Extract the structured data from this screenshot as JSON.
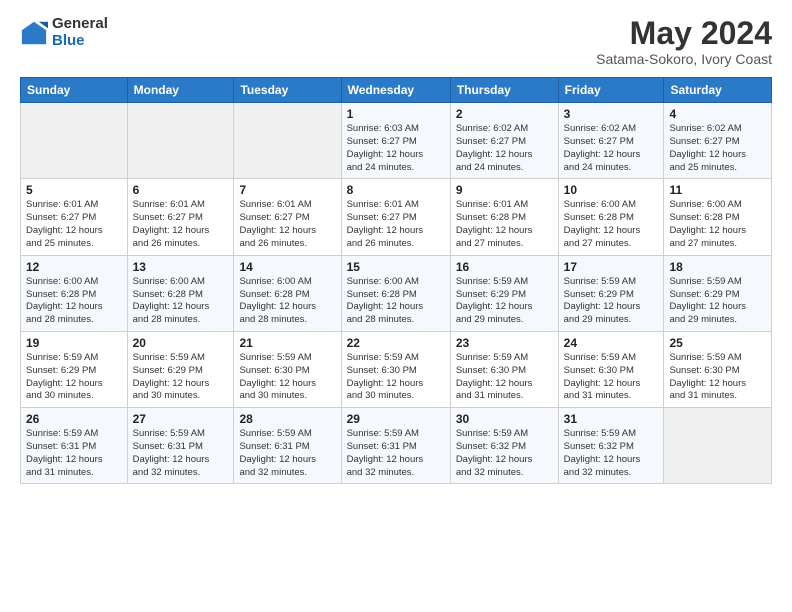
{
  "logo": {
    "general": "General",
    "blue": "Blue"
  },
  "title": "May 2024",
  "location": "Satama-Sokoro, Ivory Coast",
  "weekdays": [
    "Sunday",
    "Monday",
    "Tuesday",
    "Wednesday",
    "Thursday",
    "Friday",
    "Saturday"
  ],
  "weeks": [
    [
      {
        "num": "",
        "detail": ""
      },
      {
        "num": "",
        "detail": ""
      },
      {
        "num": "",
        "detail": ""
      },
      {
        "num": "1",
        "detail": "Sunrise: 6:03 AM\nSunset: 6:27 PM\nDaylight: 12 hours\nand 24 minutes."
      },
      {
        "num": "2",
        "detail": "Sunrise: 6:02 AM\nSunset: 6:27 PM\nDaylight: 12 hours\nand 24 minutes."
      },
      {
        "num": "3",
        "detail": "Sunrise: 6:02 AM\nSunset: 6:27 PM\nDaylight: 12 hours\nand 24 minutes."
      },
      {
        "num": "4",
        "detail": "Sunrise: 6:02 AM\nSunset: 6:27 PM\nDaylight: 12 hours\nand 25 minutes."
      }
    ],
    [
      {
        "num": "5",
        "detail": "Sunrise: 6:01 AM\nSunset: 6:27 PM\nDaylight: 12 hours\nand 25 minutes."
      },
      {
        "num": "6",
        "detail": "Sunrise: 6:01 AM\nSunset: 6:27 PM\nDaylight: 12 hours\nand 26 minutes."
      },
      {
        "num": "7",
        "detail": "Sunrise: 6:01 AM\nSunset: 6:27 PM\nDaylight: 12 hours\nand 26 minutes."
      },
      {
        "num": "8",
        "detail": "Sunrise: 6:01 AM\nSunset: 6:27 PM\nDaylight: 12 hours\nand 26 minutes."
      },
      {
        "num": "9",
        "detail": "Sunrise: 6:01 AM\nSunset: 6:28 PM\nDaylight: 12 hours\nand 27 minutes."
      },
      {
        "num": "10",
        "detail": "Sunrise: 6:00 AM\nSunset: 6:28 PM\nDaylight: 12 hours\nand 27 minutes."
      },
      {
        "num": "11",
        "detail": "Sunrise: 6:00 AM\nSunset: 6:28 PM\nDaylight: 12 hours\nand 27 minutes."
      }
    ],
    [
      {
        "num": "12",
        "detail": "Sunrise: 6:00 AM\nSunset: 6:28 PM\nDaylight: 12 hours\nand 28 minutes."
      },
      {
        "num": "13",
        "detail": "Sunrise: 6:00 AM\nSunset: 6:28 PM\nDaylight: 12 hours\nand 28 minutes."
      },
      {
        "num": "14",
        "detail": "Sunrise: 6:00 AM\nSunset: 6:28 PM\nDaylight: 12 hours\nand 28 minutes."
      },
      {
        "num": "15",
        "detail": "Sunrise: 6:00 AM\nSunset: 6:28 PM\nDaylight: 12 hours\nand 28 minutes."
      },
      {
        "num": "16",
        "detail": "Sunrise: 5:59 AM\nSunset: 6:29 PM\nDaylight: 12 hours\nand 29 minutes."
      },
      {
        "num": "17",
        "detail": "Sunrise: 5:59 AM\nSunset: 6:29 PM\nDaylight: 12 hours\nand 29 minutes."
      },
      {
        "num": "18",
        "detail": "Sunrise: 5:59 AM\nSunset: 6:29 PM\nDaylight: 12 hours\nand 29 minutes."
      }
    ],
    [
      {
        "num": "19",
        "detail": "Sunrise: 5:59 AM\nSunset: 6:29 PM\nDaylight: 12 hours\nand 30 minutes."
      },
      {
        "num": "20",
        "detail": "Sunrise: 5:59 AM\nSunset: 6:29 PM\nDaylight: 12 hours\nand 30 minutes."
      },
      {
        "num": "21",
        "detail": "Sunrise: 5:59 AM\nSunset: 6:30 PM\nDaylight: 12 hours\nand 30 minutes."
      },
      {
        "num": "22",
        "detail": "Sunrise: 5:59 AM\nSunset: 6:30 PM\nDaylight: 12 hours\nand 30 minutes."
      },
      {
        "num": "23",
        "detail": "Sunrise: 5:59 AM\nSunset: 6:30 PM\nDaylight: 12 hours\nand 31 minutes."
      },
      {
        "num": "24",
        "detail": "Sunrise: 5:59 AM\nSunset: 6:30 PM\nDaylight: 12 hours\nand 31 minutes."
      },
      {
        "num": "25",
        "detail": "Sunrise: 5:59 AM\nSunset: 6:30 PM\nDaylight: 12 hours\nand 31 minutes."
      }
    ],
    [
      {
        "num": "26",
        "detail": "Sunrise: 5:59 AM\nSunset: 6:31 PM\nDaylight: 12 hours\nand 31 minutes."
      },
      {
        "num": "27",
        "detail": "Sunrise: 5:59 AM\nSunset: 6:31 PM\nDaylight: 12 hours\nand 32 minutes."
      },
      {
        "num": "28",
        "detail": "Sunrise: 5:59 AM\nSunset: 6:31 PM\nDaylight: 12 hours\nand 32 minutes."
      },
      {
        "num": "29",
        "detail": "Sunrise: 5:59 AM\nSunset: 6:31 PM\nDaylight: 12 hours\nand 32 minutes."
      },
      {
        "num": "30",
        "detail": "Sunrise: 5:59 AM\nSunset: 6:32 PM\nDaylight: 12 hours\nand 32 minutes."
      },
      {
        "num": "31",
        "detail": "Sunrise: 5:59 AM\nSunset: 6:32 PM\nDaylight: 12 hours\nand 32 minutes."
      },
      {
        "num": "",
        "detail": ""
      }
    ]
  ]
}
